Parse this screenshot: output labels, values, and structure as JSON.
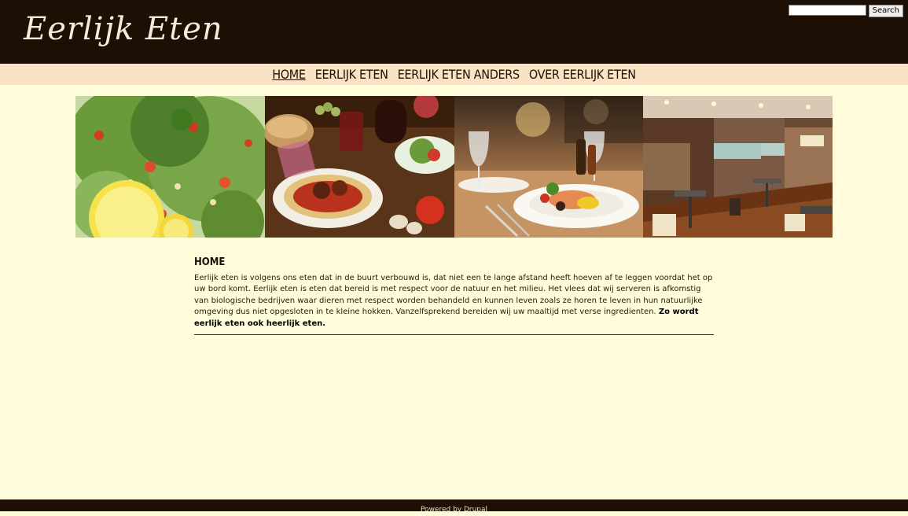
{
  "site": {
    "logo": "Eerlijk Eten"
  },
  "search": {
    "button_label": "Search",
    "value": ""
  },
  "nav": {
    "items": [
      {
        "label": "HOME",
        "active": true
      },
      {
        "label": "EERLIJK ETEN",
        "active": false
      },
      {
        "label": "EERLIJK ETEN ANDERS",
        "active": false
      },
      {
        "label": "OVER EERLIJK ETEN",
        "active": false
      }
    ]
  },
  "content": {
    "title": "HOME",
    "body": "Eerlijk eten is volgens ons eten dat in de buurt verbouwd is, dat niet een te lange afstand heeft hoeven af te leggen voordat het op uw bord komt. Eerlijk eten is eten dat bereid is met respect voor de natuur en het milieu. Het vlees dat wij serveren is afkomstig van biologische bedrijven waar dieren met respect worden behandeld en kunnen leven zoals ze horen te leven in hun natuurlijke omgeving dus niet opgesloten in te kleine hokken. Vanzelfsprekend bereiden wij uw maaltijd met verse ingredienten.",
    "body_bold": "Zo wordt eerlijk eten ook heerlijk eten."
  },
  "footer": {
    "text": "Powered by Drupal"
  },
  "colors": {
    "header_bg": "#1e0f04",
    "nav_bg": "#fae3c4",
    "page_bg": "#fffcdc"
  }
}
